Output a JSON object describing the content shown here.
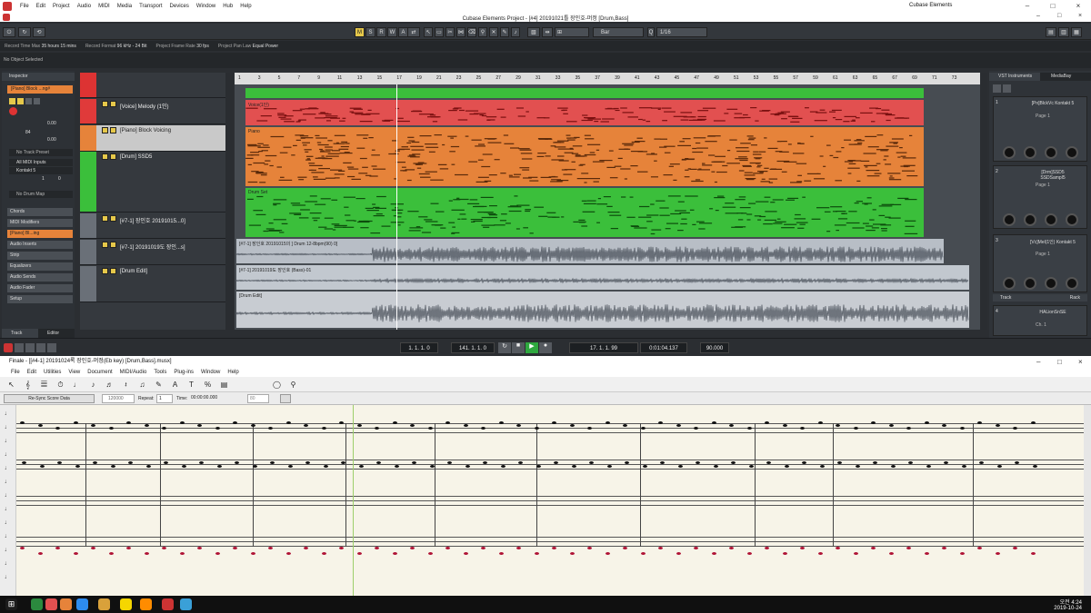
{
  "cubase": {
    "menu": [
      "File",
      "Edit",
      "Project",
      "Audio",
      "MIDI",
      "Media",
      "Transport",
      "Devices",
      "Window",
      "Hub",
      "Help"
    ],
    "app_name": "Cubase Elements",
    "window_title": "Cubase Elements Project - [#4] 20191021틀 장인호-머정 [Drum,Bass]",
    "toolbar": {
      "msrw": [
        "M",
        "S",
        "R",
        "W",
        "A"
      ],
      "snap": "Bar",
      "quantize": "1/16"
    },
    "infoline": [
      {
        "k": "Record Time Max",
        "v": "35 hours 15 mins"
      },
      {
        "k": "Record Format",
        "v": "96 kHz - 24 Bit"
      },
      {
        "k": "Project Frame Rate",
        "v": "30 fps"
      },
      {
        "k": "Project Pan Law",
        "v": "Equal Power"
      }
    ],
    "no_object": "No Object Selected",
    "inspector": {
      "tab": "Inspector",
      "track": "[Piano] Block ...ng#",
      "vol": "0.00",
      "pan": "0.00",
      "pan_val": "84",
      "no_track_preset": "No Track Preset",
      "midi_input": "All MIDI Inputs",
      "instrument": "Kontakt 5",
      "channel": "1",
      "prog": "0",
      "drum_map": "No Drum Map",
      "sections": [
        "Chords",
        "MIDI Modifiers",
        "[Piano] Bl...ing",
        "Audio Inserts",
        "Strip",
        "Equalizers",
        "Audio Sends",
        "Audio Fader",
        "Setup"
      ],
      "bottom_tabs": [
        "Track",
        "Editor"
      ]
    },
    "tracks": [
      {
        "name": "[Voice] Melody (1인)",
        "color": "#e03a3a"
      },
      {
        "name": "[Piano] Block Voicing",
        "color": "#e6833a"
      },
      {
        "name": "[Drum] SSD5",
        "color": "#3bbf3b"
      },
      {
        "name": "[#7-1] 장인호 20191015...0]",
        "color": "#6a7078"
      },
      {
        "name": "[#7-1] 20191019도 장인...s]",
        "color": "#6a7078"
      },
      {
        "name": "[Drum Edit]",
        "color": "#6a7078"
      }
    ],
    "ruler": [
      "1",
      "3",
      "5",
      "7",
      "9",
      "11",
      "13",
      "15",
      "17",
      "19",
      "21",
      "23",
      "25",
      "27",
      "29",
      "31",
      "33",
      "35",
      "37",
      "39",
      "41",
      "43",
      "45",
      "47",
      "49",
      "51",
      "53",
      "55",
      "57",
      "59",
      "61",
      "63",
      "65",
      "67",
      "69",
      "71",
      "73"
    ],
    "events": [
      "Voice(1인)",
      "Piano",
      "Drum Set",
      "[#7-1] 장인호 20191015의 ] Drum 12-8bpm(90) 0]",
      "[#7-1] 20191019도 장인호 (Bass)-01",
      "[Drum Edit]"
    ],
    "transport": {
      "left": "1. 1. 1. 0",
      "right": "141. 1. 1. 0",
      "pos": "17. 1. 1. 99",
      "time": "0:01:04.137",
      "tempo": "90.000"
    },
    "rack": {
      "tabs": [
        "VST Instruments",
        "MediaBay"
      ],
      "slots": [
        {
          "num": "1",
          "name": "[Pn]BlckVc Kontakt 5",
          "page": "Page 1"
        },
        {
          "num": "2",
          "name": "[Drm]SSD5 SSDSampl5",
          "page": "Page 1"
        },
        {
          "num": "3",
          "name": "[Vc]Mel(1인) Kontakt 5",
          "page": "Page 1"
        },
        {
          "num": "4",
          "name": "HALionSnSE",
          "page": "Ch. 1"
        }
      ],
      "section": "Track",
      "rack_label": "Rack"
    }
  },
  "finale": {
    "window_title": "Finale - [[#4-1] 20191024록 장인호-머정(Eb key) [Drum,Bass].musx]",
    "menu": [
      "File",
      "Edit",
      "Utilities",
      "View",
      "Document",
      "MIDI/Audio",
      "Tools",
      "Plug-ins",
      "Window",
      "Help"
    ],
    "resync": "Re-Sync Score Data",
    "playback": {
      "tempo": "120000",
      "repeat": "Repeat:",
      "repeat_val": "1",
      "time_label": "Time:",
      "time": "00:00:00.000",
      "measure": "80"
    }
  },
  "taskbar": {
    "time": "오전 4:24",
    "date": "2019-10-24"
  },
  "colors": {
    "voice": "#e03a3a",
    "piano": "#e6833a",
    "drum": "#3bbf3b",
    "accent": "#d44"
  }
}
